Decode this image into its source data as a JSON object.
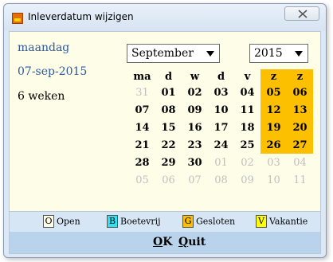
{
  "window": {
    "title": "Inleverdatum wijzigen"
  },
  "info": {
    "day_name": "maandag",
    "date": "07-sep-2015",
    "duration": "6 weken"
  },
  "month_select": {
    "value": "September"
  },
  "year_select": {
    "value": "2015"
  },
  "calendar": {
    "headers": [
      "ma",
      "d",
      "w",
      "d",
      "v",
      "z",
      "z"
    ],
    "rows": [
      [
        {
          "d": "31",
          "o": true
        },
        {
          "d": "01"
        },
        {
          "d": "02"
        },
        {
          "d": "03"
        },
        {
          "d": "04"
        },
        {
          "d": "05",
          "w": true
        },
        {
          "d": "06",
          "w": true
        }
      ],
      [
        {
          "d": "07"
        },
        {
          "d": "08"
        },
        {
          "d": "09"
        },
        {
          "d": "10"
        },
        {
          "d": "11"
        },
        {
          "d": "12",
          "w": true
        },
        {
          "d": "13",
          "w": true
        }
      ],
      [
        {
          "d": "14"
        },
        {
          "d": "15"
        },
        {
          "d": "16"
        },
        {
          "d": "17"
        },
        {
          "d": "18"
        },
        {
          "d": "19",
          "w": true
        },
        {
          "d": "20",
          "w": true
        }
      ],
      [
        {
          "d": "21"
        },
        {
          "d": "22"
        },
        {
          "d": "23"
        },
        {
          "d": "24"
        },
        {
          "d": "25"
        },
        {
          "d": "26",
          "w": true
        },
        {
          "d": "27",
          "w": true
        }
      ],
      [
        {
          "d": "28"
        },
        {
          "d": "29"
        },
        {
          "d": "30"
        },
        {
          "d": "01",
          "o": true
        },
        {
          "d": "02",
          "o": true
        },
        {
          "d": "03",
          "o": true
        },
        {
          "d": "04",
          "o": true
        }
      ],
      [
        {
          "d": "05",
          "o": true
        },
        {
          "d": "06",
          "o": true
        },
        {
          "d": "07",
          "o": true
        },
        {
          "d": "08",
          "o": true
        },
        {
          "d": "09",
          "o": true
        },
        {
          "d": "10",
          "o": true
        },
        {
          "d": "11",
          "o": true
        }
      ]
    ],
    "weekend_color": "#fcc000"
  },
  "legend": [
    {
      "key": "O",
      "label": "Open",
      "color": "#fdfde8"
    },
    {
      "key": "B",
      "label": "Boetevrij",
      "color": "#33e0f0"
    },
    {
      "key": "G",
      "label": "Gesloten",
      "color": "#fcc000"
    },
    {
      "key": "V",
      "label": "Vakantie",
      "color": "#ffff00"
    }
  ],
  "actions": {
    "ok_u": "O",
    "ok_rest": "K",
    "quit_u": "Q",
    "quit_rest": "uit"
  }
}
